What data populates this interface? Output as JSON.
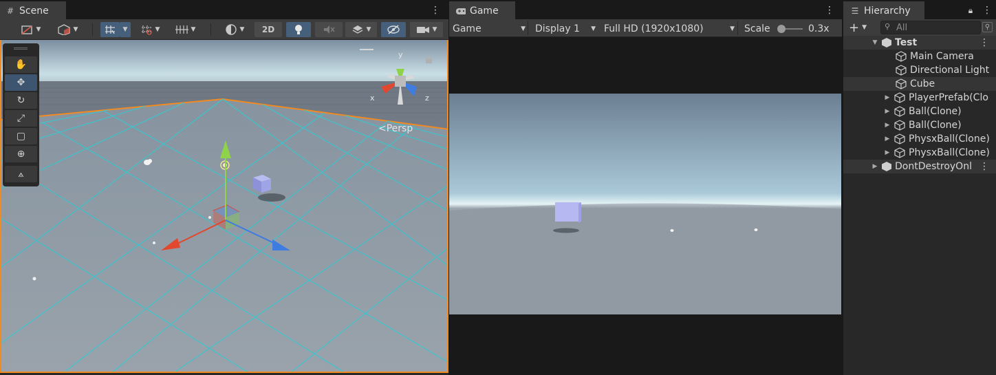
{
  "scene_panel": {
    "tab_label": "Scene",
    "tab_icon": "grid-icon",
    "toolbar": {
      "two_d_label": "2D"
    },
    "persp_label": "Persp",
    "gizmo": {
      "x_label": "x",
      "y_label": "y",
      "z_label": "z"
    },
    "tools": [
      "hand-tool",
      "move-tool",
      "rotate-tool",
      "scale-tool",
      "rect-tool",
      "transform-tool",
      "custom-tool"
    ]
  },
  "game_panel": {
    "tab_label": "Game",
    "tab_icon": "gamepad-icon",
    "mode_label": "Game",
    "display_label": "Display 1",
    "resolution_label": "Full HD (1920x1080)",
    "scale_label": "Scale",
    "scale_value": "0.3x",
    "scale_level": 0.3
  },
  "hierarchy_panel": {
    "tab_label": "Hierarchy",
    "search_placeholder": "All",
    "scene_name": "Test",
    "items": [
      {
        "label": "Main Camera"
      },
      {
        "label": "Directional Light"
      },
      {
        "label": "Cube"
      },
      {
        "label": "PlayerPrefab(Clo"
      },
      {
        "label": "Ball(Clone)"
      },
      {
        "label": "Ball(Clone)"
      },
      {
        "label": "PhysxBall(Clone)"
      },
      {
        "label": "PhysxBall(Clone)"
      }
    ],
    "dont_destroy_label": "DontDestroyOnl"
  },
  "colors": {
    "selection_outline": "#f28a22",
    "grid_line": "#35c7d0",
    "active_button": "#46607c",
    "x_axis": "#e0412c",
    "y_axis": "#8fd34a",
    "z_axis": "#3f7ce0"
  }
}
